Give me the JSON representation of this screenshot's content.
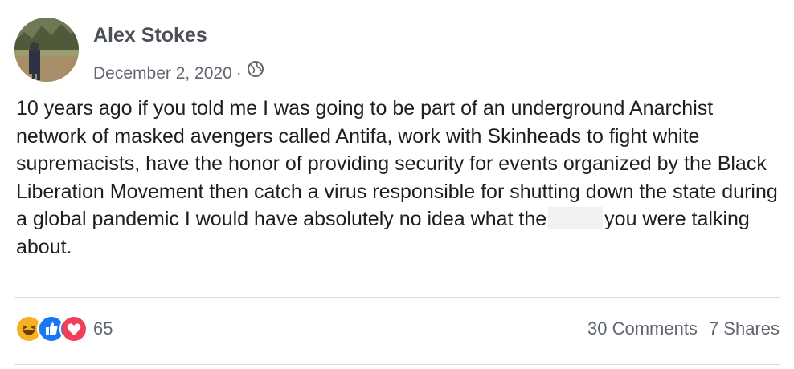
{
  "post": {
    "author": "Alex Stokes",
    "date": "December 2, 2020",
    "separator": "·",
    "privacy_icon": "globe-icon",
    "text_before_redaction": "10 years ago if you told me I was going to be part of an underground Anarchist network of masked avengers called Antifa, work with Skinheads to fight white supremacists, have the honor of providing security for events organized by the Black Liberation Movement then catch a virus responsible for shutting down the state during a global pandemic I would have absolutely no idea what the",
    "text_after_redaction": "you were talking about."
  },
  "footer": {
    "reaction_icons": [
      "haha-icon",
      "like-icon",
      "love-icon"
    ],
    "reaction_count": "65",
    "comments": "30 Comments",
    "shares": "7 Shares"
  },
  "colors": {
    "author": "#4b4f56",
    "meta": "#606770",
    "like": "#1877f2",
    "love": "#f33e58",
    "haha": "#f7b125",
    "divider": "#dadde1"
  }
}
